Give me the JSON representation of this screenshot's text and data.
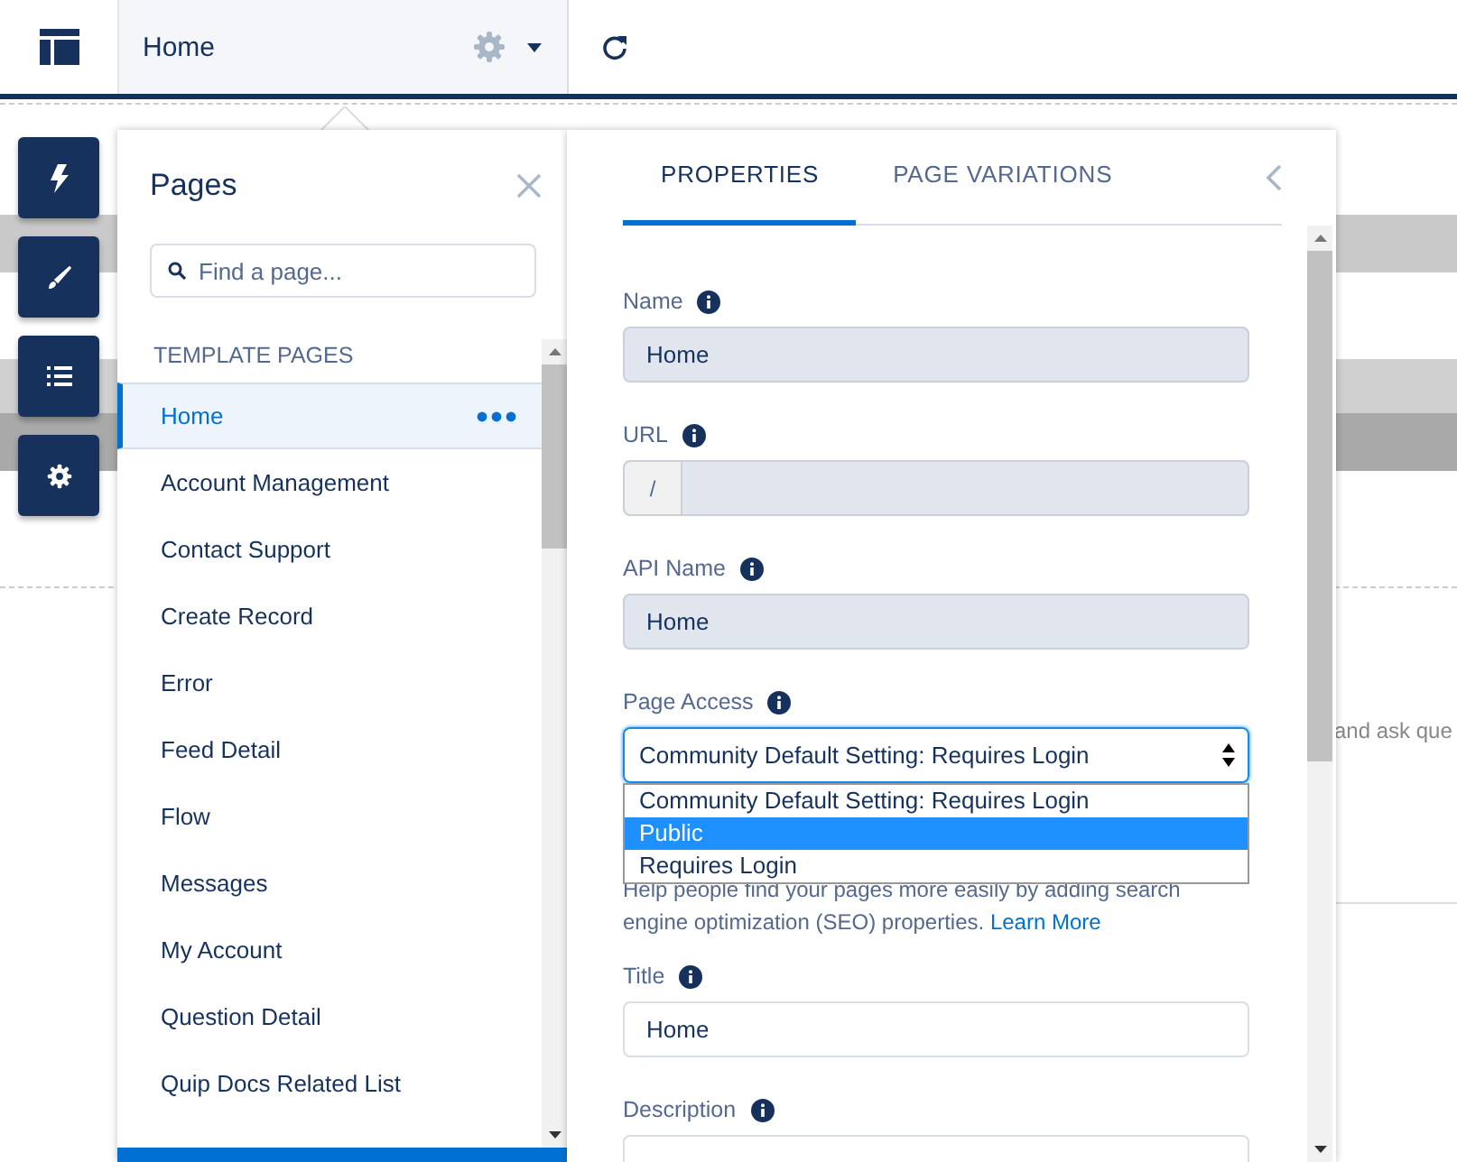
{
  "toolbar": {
    "page_name": "Home"
  },
  "pages_panel": {
    "title": "Pages",
    "search": {
      "placeholder": "Find a page..."
    },
    "section": "TEMPLATE PAGES",
    "items": [
      {
        "label": "Home",
        "selected": true
      },
      {
        "label": "Account Management",
        "selected": false
      },
      {
        "label": "Contact Support",
        "selected": false
      },
      {
        "label": "Create Record",
        "selected": false
      },
      {
        "label": "Error",
        "selected": false
      },
      {
        "label": "Feed Detail",
        "selected": false
      },
      {
        "label": "Flow",
        "selected": false
      },
      {
        "label": "Messages",
        "selected": false
      },
      {
        "label": "My Account",
        "selected": false
      },
      {
        "label": "Question Detail",
        "selected": false
      },
      {
        "label": "Quip Docs Related List",
        "selected": false
      }
    ]
  },
  "properties_panel": {
    "tabs": [
      {
        "label": "PROPERTIES",
        "selected": true
      },
      {
        "label": "PAGE VARIATIONS",
        "selected": false
      }
    ],
    "fields": [
      {
        "kind": "text",
        "label": "Name",
        "value": "Home",
        "disabled": true
      },
      {
        "kind": "url",
        "label": "URL",
        "prefix": "/",
        "disabled": true
      },
      {
        "kind": "text",
        "label": "API Name",
        "value": "Home",
        "disabled": true
      },
      {
        "kind": "select",
        "label": "Page Access",
        "value": "Community Default Setting: Requires Login",
        "expanded": true,
        "options": [
          {
            "label": "Community Default Setting: Requires Login",
            "highlighted": false
          },
          {
            "label": "Public",
            "highlighted": true
          },
          {
            "label": "Requires Login",
            "highlighted": false
          }
        ]
      },
      {
        "kind": "help",
        "text": "Help people find your pages more easily by adding search engine optimization (SEO) properties.",
        "link": "Learn More"
      },
      {
        "kind": "text",
        "label": "Title",
        "value": "Home",
        "disabled": false
      },
      {
        "kind": "text",
        "label": "Description",
        "disabled": false
      }
    ]
  },
  "background": {
    "text": "and ask que"
  }
}
